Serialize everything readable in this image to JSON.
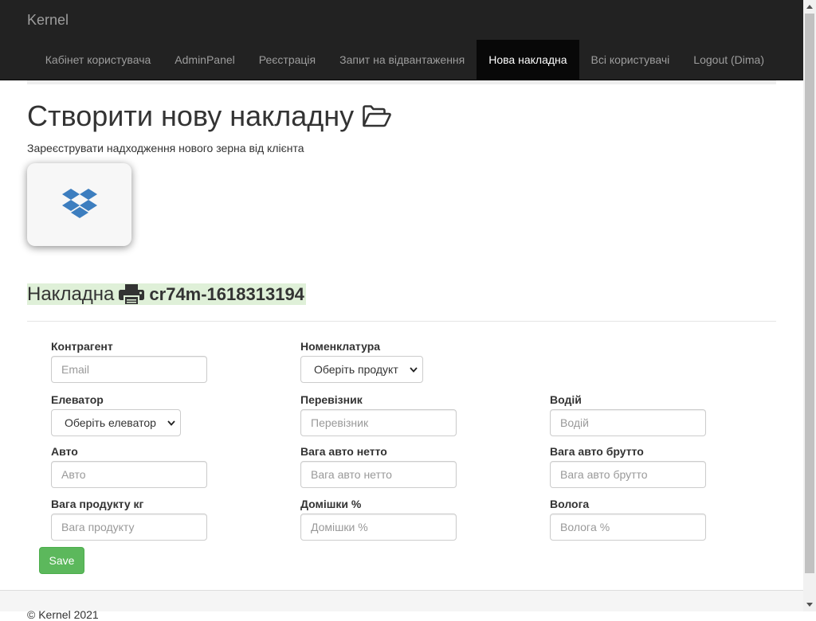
{
  "navbar": {
    "brand": "Kernel",
    "items": [
      {
        "label": "Кабінет користувача",
        "active": false
      },
      {
        "label": "AdminPanel",
        "active": false
      },
      {
        "label": "Реєстрація",
        "active": false
      },
      {
        "label": "Запит на відвантаження",
        "active": false
      },
      {
        "label": "Нова накладна",
        "active": true
      },
      {
        "label": "Всі користувачі",
        "active": false
      },
      {
        "label": "Logout (Dima)",
        "active": false
      }
    ]
  },
  "header": {
    "title": "Створити нову накладну",
    "title_icon": "folder-open-icon",
    "subtitle": "Зареєструвати надходження нового зерна від клієнта"
  },
  "dropbox": {
    "icon": "dropbox-icon",
    "color": "#3d7ebf"
  },
  "invoice": {
    "label": "Накладна",
    "icon": "printer-icon",
    "number": "cr74m-1618313194",
    "highlight_color": "#dff0d8"
  },
  "form": {
    "counterparty": {
      "label": "Контрагент",
      "placeholder": "Email"
    },
    "nomenclature": {
      "label": "Номенклатура",
      "selected": "Оберіть продукт"
    },
    "elevator": {
      "label": "Елеватор",
      "selected": "Оберіть елеватор"
    },
    "carrier": {
      "label": "Перевізник",
      "placeholder": "Перевізник"
    },
    "driver": {
      "label": "Водій",
      "placeholder": "Водій"
    },
    "auto": {
      "label": "Авто",
      "placeholder": "Авто"
    },
    "net_weight": {
      "label": "Вага авто нетто",
      "placeholder": "Вага авто нетто"
    },
    "gross_weight": {
      "label": "Вага авто брутто",
      "placeholder": "Вага авто брутто"
    },
    "product_weight": {
      "label": "Вага продукту кг",
      "placeholder": "Вага продукту"
    },
    "impurities": {
      "label": "Домішки %",
      "placeholder": "Домішки %"
    },
    "moisture": {
      "label": "Вологa",
      "placeholder": "Вологa %"
    },
    "save_label": "Save",
    "save_color": "#5cb85c"
  },
  "footer": {
    "text": "© Kernel 2021"
  }
}
